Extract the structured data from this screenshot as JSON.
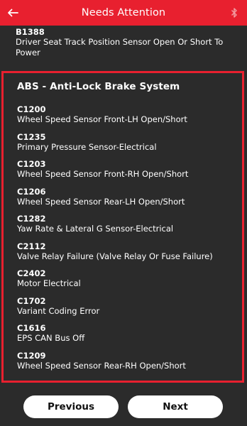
{
  "header": {
    "title": "Needs Attention",
    "back_icon": "arrow-left-icon",
    "status_icon": "bluetooth-icon",
    "color": "#e8202f"
  },
  "previous_item": {
    "code": "B1388",
    "description": "Driver Seat Track Position Sensor Open Or Short To Power"
  },
  "system": {
    "title": "ABS - Anti-Lock Brake System",
    "border_color": "#e8202f",
    "dtcs": [
      {
        "code": "C1200",
        "description": "Wheel Speed Sensor Front-LH Open/Short"
      },
      {
        "code": "C1235",
        "description": "Primary Pressure Sensor-Electrical"
      },
      {
        "code": "C1203",
        "description": "Wheel Speed Sensor Front-RH Open/Short"
      },
      {
        "code": "C1206",
        "description": "Wheel Speed Sensor Rear-LH Open/Short"
      },
      {
        "code": "C1282",
        "description": "Yaw Rate & Lateral G Sensor-Electrical"
      },
      {
        "code": "C2112",
        "description": "Valve Relay Failure (Valve Relay Or Fuse Failure)"
      },
      {
        "code": "C2402",
        "description": "Motor Electrical"
      },
      {
        "code": "C1702",
        "description": "Variant Coding Error"
      },
      {
        "code": "C1616",
        "description": "EPS CAN Bus Off"
      },
      {
        "code": "C1209",
        "description": "Wheel Speed Sensor Rear-RH Open/Short"
      }
    ]
  },
  "footer": {
    "previous_label": "Previous",
    "next_label": "Next"
  }
}
